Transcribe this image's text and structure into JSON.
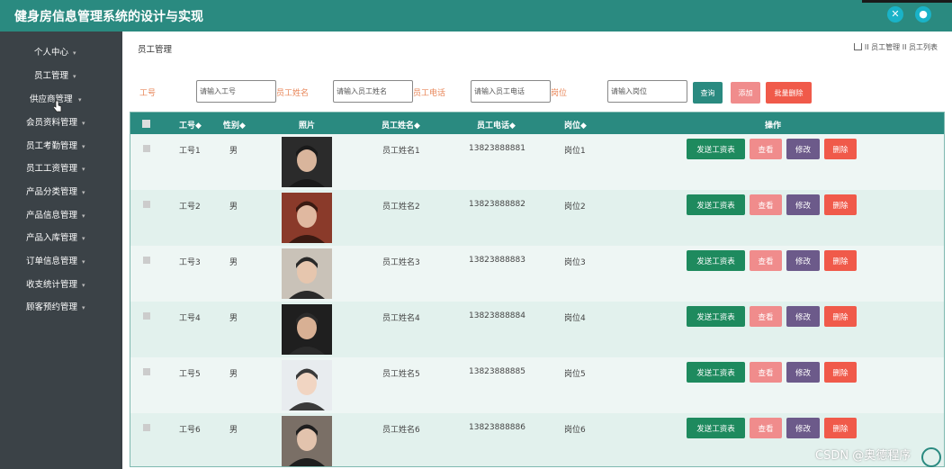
{
  "app": {
    "title": "健身房信息管理系统的设计与实现"
  },
  "topbar": {
    "fullscreen_icon": "expand-icon",
    "user_icon": "user-icon"
  },
  "sidebar": {
    "items": [
      {
        "label": "个人中心",
        "arrow": "▾"
      },
      {
        "label": "员工管理",
        "arrow": "▾"
      },
      {
        "label": "供应商管理",
        "arrow": "▾"
      },
      {
        "label": "会员资料管理",
        "arrow": "▾"
      },
      {
        "label": "员工考勤管理",
        "arrow": "▾"
      },
      {
        "label": "员工工资管理",
        "arrow": "▾"
      },
      {
        "label": "产品分类管理",
        "arrow": "▾"
      },
      {
        "label": "产品信息管理",
        "arrow": "▾"
      },
      {
        "label": "产品入库管理",
        "arrow": "▾"
      },
      {
        "label": "订单信息管理",
        "arrow": "▾"
      },
      {
        "label": "收支统计管理",
        "arrow": "▾"
      },
      {
        "label": "顾客预约管理",
        "arrow": "▾"
      }
    ]
  },
  "main": {
    "page_title": "员工管理",
    "breadcrumb": "II 员工管理 II 员工列表"
  },
  "filters": {
    "gonghao_label": "工号",
    "gonghao_placeholder": "请输入工号",
    "name_label": "员工姓名",
    "name_placeholder": "请输入员工姓名",
    "phone_label": "员工电话",
    "phone_placeholder": "请输入员工电话",
    "post_label": "岗位",
    "post_placeholder": "请输入岗位",
    "search_button": "查询",
    "add_button": "添加",
    "batch_delete_button": "批量删除"
  },
  "table": {
    "headers": {
      "gonghao": "工号◆",
      "gender": "性别◆",
      "photo": "照片",
      "name": "员工姓名◆",
      "phone": "员工电话◆",
      "post": "岗位◆",
      "actions": "操作"
    },
    "action_labels": {
      "send": "发送工资表",
      "view": "查看",
      "edit": "修改",
      "delete": "删除"
    },
    "rows": [
      {
        "gonghao": "工号1",
        "gender": "男",
        "name": "员工姓名1",
        "phone": "13823888881",
        "post": "岗位1"
      },
      {
        "gonghao": "工号2",
        "gender": "男",
        "name": "员工姓名2",
        "phone": "13823888882",
        "post": "岗位2"
      },
      {
        "gonghao": "工号3",
        "gender": "男",
        "name": "员工姓名3",
        "phone": "13823888883",
        "post": "岗位3"
      },
      {
        "gonghao": "工号4",
        "gender": "男",
        "name": "员工姓名4",
        "phone": "13823888884",
        "post": "岗位4"
      },
      {
        "gonghao": "工号5",
        "gender": "男",
        "name": "员工姓名5",
        "phone": "13823888885",
        "post": "岗位5"
      },
      {
        "gonghao": "工号6",
        "gender": "男",
        "name": "员工姓名6",
        "phone": "13823888886",
        "post": "岗位6"
      }
    ]
  },
  "watermark": "CSDN @奥德程序",
  "colors": {
    "brand": "#2a8a80",
    "sidebar": "#3b4247",
    "label": "#e8875a",
    "danger": "#f05a4a",
    "view": "#f08c8c",
    "edit": "#6c5a8a",
    "send": "#1e8a5e"
  }
}
